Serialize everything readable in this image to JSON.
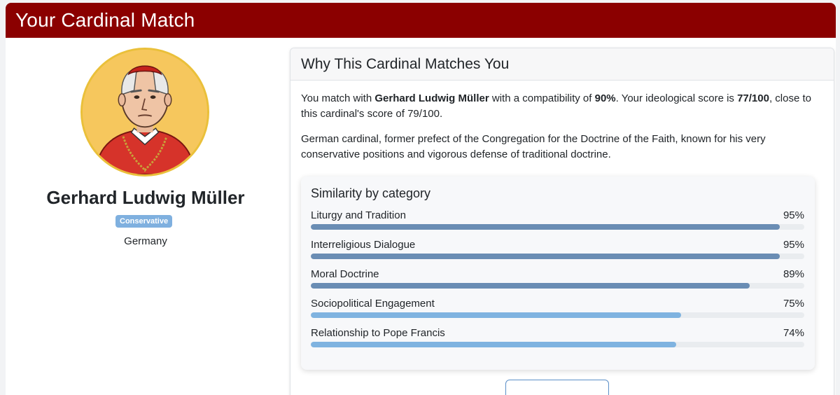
{
  "header": {
    "title": "Your Cardinal Match"
  },
  "profile": {
    "name": "Gerhard Ludwig Müller",
    "badge": "Conservative",
    "country": "Germany",
    "avatar_icon": "cardinal-portrait-icon"
  },
  "match_card": {
    "title": "Why This Cardinal Matches You",
    "summary": {
      "prefix": "You match with ",
      "name": "Gerhard Ludwig Müller",
      "mid1": " with a compatibility of ",
      "compatibility": "90%",
      "mid2": ". Your ideological score is ",
      "user_score": "77/100",
      "suffix": ", close to this cardinal's score of 79/100."
    },
    "description": "German cardinal, former prefect of the Congregation for the Doctrine of the Faith, known for his very conservative positions and vigorous defense of traditional doctrine.",
    "similarity": {
      "title": "Similarity by category",
      "items": [
        {
          "label": "Liturgy and Tradition",
          "pct_text": "95%",
          "value": 95,
          "color": "#6a8db4"
        },
        {
          "label": "Interreligious Dialogue",
          "pct_text": "95%",
          "value": 95,
          "color": "#6a8db4"
        },
        {
          "label": "Moral Doctrine",
          "pct_text": "89%",
          "value": 89,
          "color": "#6a8db4"
        },
        {
          "label": "Sociopolitical Engagement",
          "pct_text": "75%",
          "value": 75,
          "color": "#7fb3e0"
        },
        {
          "label": "Relationship to Pope Francis",
          "pct_text": "74%",
          "value": 74,
          "color": "#7fb3e0"
        }
      ]
    }
  },
  "colors": {
    "header_bg": "#8b0000",
    "badge_bg": "#7fb0df",
    "avatar_bg": "#f6c75d"
  }
}
